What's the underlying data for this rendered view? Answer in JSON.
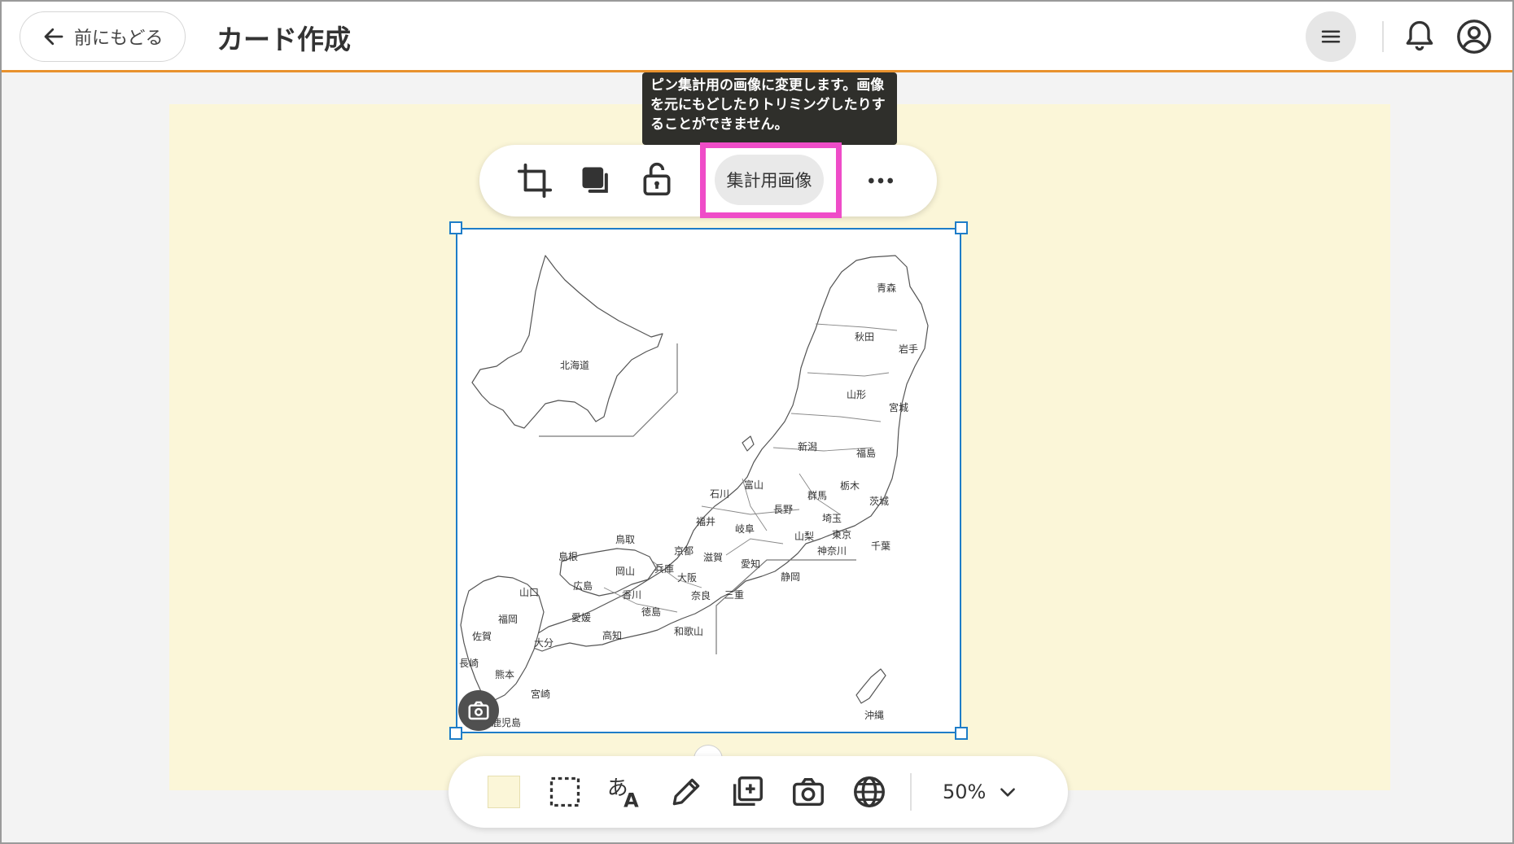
{
  "header": {
    "back_label": "前にもどる",
    "title": "カード作成"
  },
  "tooltip": {
    "text": "ピン集計用の画像に変更します。画像を元にもどしたりトリミングしたりすることができません。"
  },
  "image_toolbar": {
    "aggregate_label": "集計用画像"
  },
  "map": {
    "labels": [
      "青森",
      "秋田",
      "岩手",
      "山形",
      "宮城",
      "新潟",
      "福島",
      "北海道",
      "富山",
      "石川",
      "群馬",
      "栃木",
      "長野",
      "茨城",
      "福井",
      "埼玉",
      "岐阜",
      "山梨",
      "東京",
      "千葉",
      "鳥取",
      "京都",
      "滋賀",
      "神奈川",
      "島根",
      "岡山",
      "兵庫",
      "愛知",
      "静岡",
      "広島",
      "大阪",
      "山口",
      "香川",
      "奈良",
      "三重",
      "福岡",
      "愛媛",
      "徳島",
      "佐賀",
      "大分",
      "高知",
      "和歌山",
      "長崎",
      "熊本",
      "宮崎",
      "沖縄",
      "鹿児島"
    ]
  },
  "bottom_toolbar": {
    "zoom_value": "50%"
  },
  "colors": {
    "accent": "#e8912d",
    "card_background": "#fbf6d8",
    "selection": "#1e7dc8",
    "highlight": "#ef4cc8"
  }
}
